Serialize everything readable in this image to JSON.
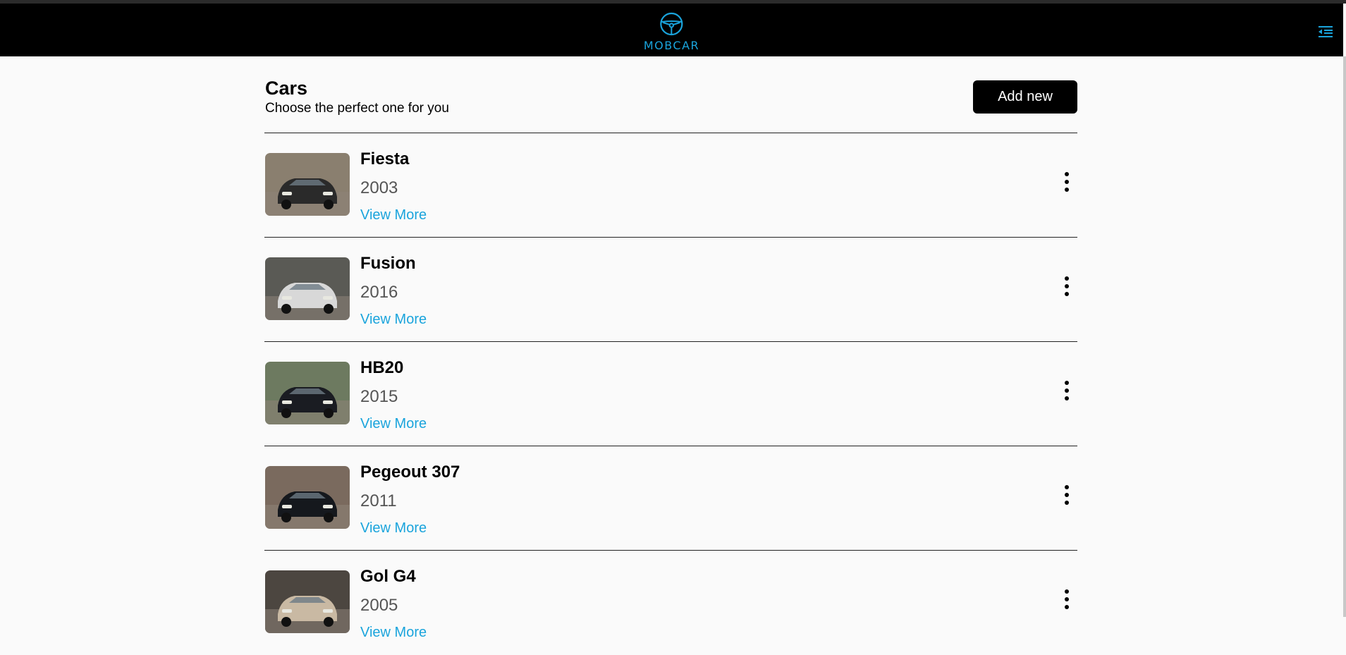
{
  "app": {
    "brand": "MOBCAR",
    "accent_color": "#1aa4dc",
    "header_bg": "#000000",
    "logo_icon": "steering-wheel-icon",
    "menu_icon": "menu-collapse-icon"
  },
  "page": {
    "title": "Cars",
    "subtitle": "Choose the perfect one for you",
    "add_button_label": "Add new"
  },
  "cars": [
    {
      "name": "Fiesta",
      "year": "2003",
      "link_label": "View More",
      "photo": "dark-hatchback-car-image",
      "body_color": "#2a2a2a",
      "bg": "#8a7f6f"
    },
    {
      "name": "Fusion",
      "year": "2016",
      "link_label": "View More",
      "photo": "silver-sedan-car-image",
      "body_color": "#d8d8d8",
      "bg": "#5a5a55"
    },
    {
      "name": "HB20",
      "year": "2015",
      "link_label": "View More",
      "photo": "black-hatchback-car-image",
      "body_color": "#1a1c22",
      "bg": "#6d7a60"
    },
    {
      "name": "Pegeout 307",
      "year": "2011",
      "link_label": "View More",
      "photo": "black-peugeot-car-image",
      "body_color": "#15181d",
      "bg": "#7a6a5e"
    },
    {
      "name": "Gol G4",
      "year": "2005",
      "link_label": "View More",
      "photo": "beige-car-garage-image",
      "body_color": "#c9b9a3",
      "bg": "#4c4640"
    }
  ]
}
